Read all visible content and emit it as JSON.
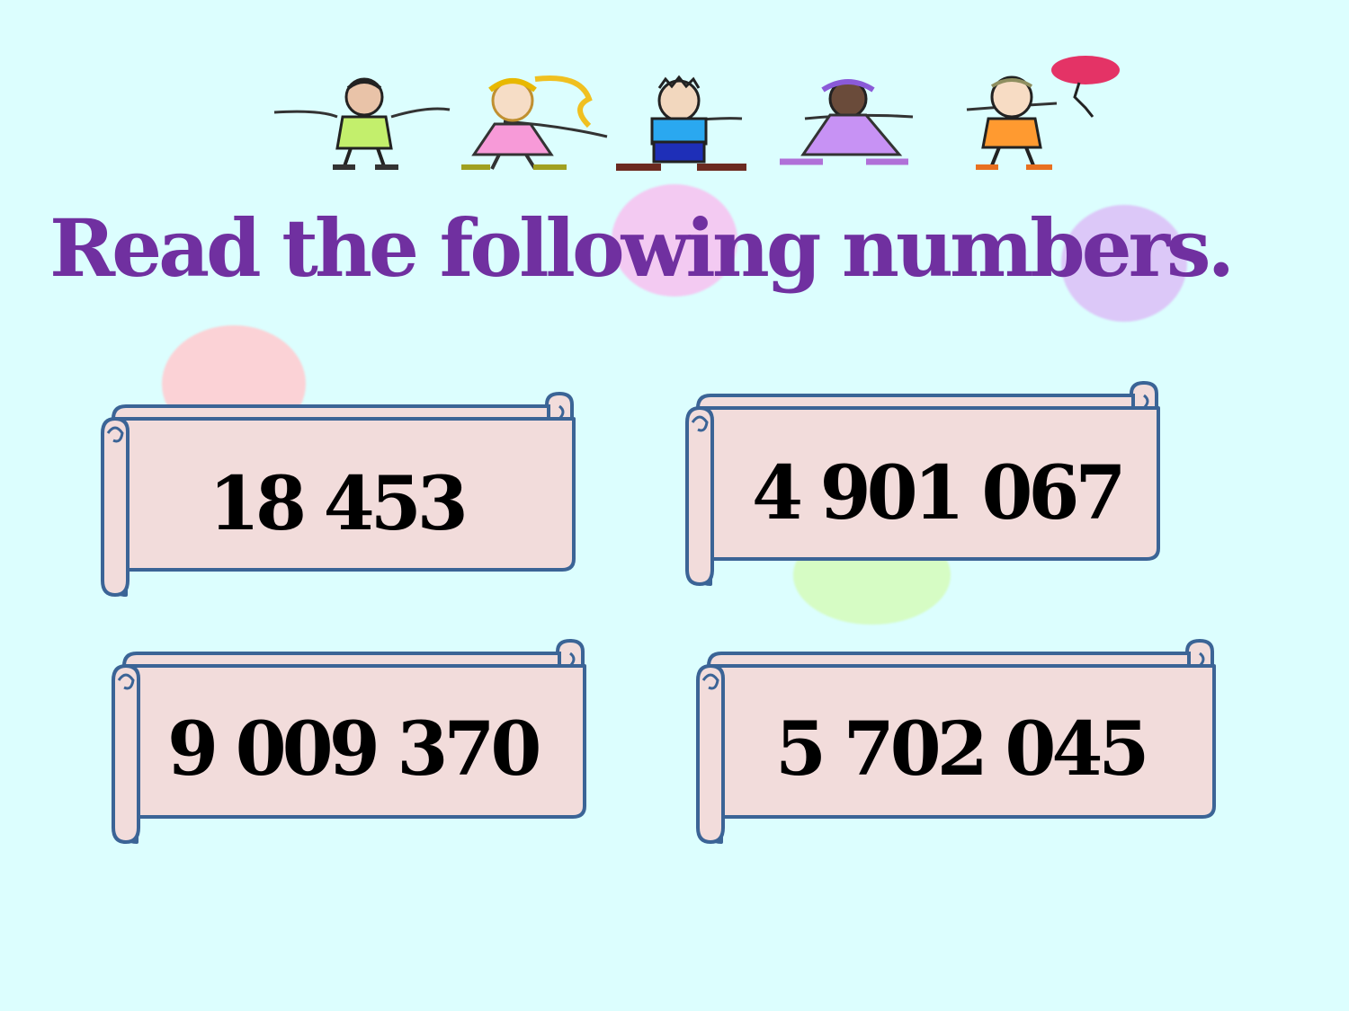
{
  "slide": {
    "title": "Read the following numbers.",
    "numbers": [
      "18 453",
      "4 901 067",
      "9 009 370",
      "5 702 045"
    ]
  },
  "colors": {
    "background": "#dcfefe",
    "title": "#7030a0",
    "scroll_fill": "#f2dcdb",
    "scroll_stroke": "#3b6496",
    "number_text": "#000000"
  },
  "decorations": {
    "banner": "children-holding-hands-clipart",
    "balloon": "red-balloon-icon"
  }
}
